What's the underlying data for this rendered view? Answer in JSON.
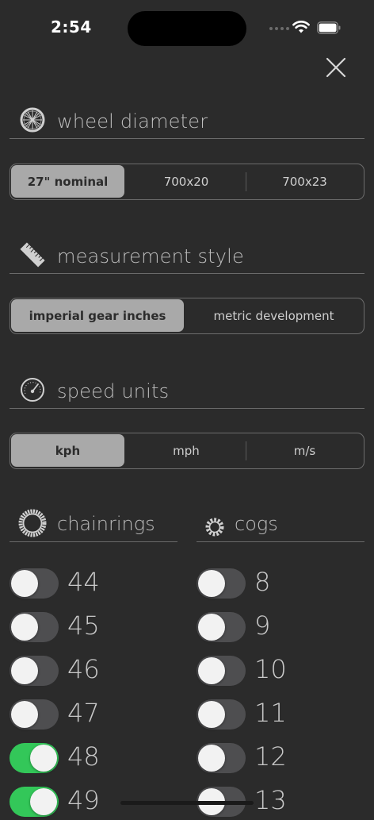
{
  "status_bar": {
    "time": "2:54"
  },
  "sections": {
    "wheel": {
      "title": "wheel diameter",
      "options": [
        "27\" nominal",
        "700x20",
        "700x23"
      ],
      "selected": "27\" nominal"
    },
    "measurement": {
      "title": "measurement style",
      "options": [
        "imperial gear inches",
        "metric development"
      ],
      "selected": "imperial gear inches"
    },
    "speed": {
      "title": "speed units",
      "options": [
        "kph",
        "mph",
        "m/s"
      ],
      "selected": "kph"
    }
  },
  "chainrings": {
    "title": "chainrings",
    "items": [
      {
        "label": "44",
        "on": false
      },
      {
        "label": "45",
        "on": false
      },
      {
        "label": "46",
        "on": false
      },
      {
        "label": "47",
        "on": false
      },
      {
        "label": "48",
        "on": true
      },
      {
        "label": "49",
        "on": true
      }
    ]
  },
  "cogs": {
    "title": "cogs",
    "items": [
      {
        "label": "8",
        "on": false
      },
      {
        "label": "9",
        "on": false
      },
      {
        "label": "10",
        "on": false
      },
      {
        "label": "11",
        "on": false
      },
      {
        "label": "12",
        "on": false
      },
      {
        "label": "13",
        "on": false
      }
    ]
  },
  "colors": {
    "background": "#2b2b2b",
    "toggle_on": "#33c759",
    "toggle_off": "#4e4e50",
    "segment_selected": "#a9a9a9"
  },
  "icons": {
    "close": "close-icon",
    "wheel": "wheel-icon",
    "ruler": "ruler-icon",
    "speedometer": "speedometer-icon",
    "chainring": "chainring-icon",
    "cog": "cog-icon"
  }
}
